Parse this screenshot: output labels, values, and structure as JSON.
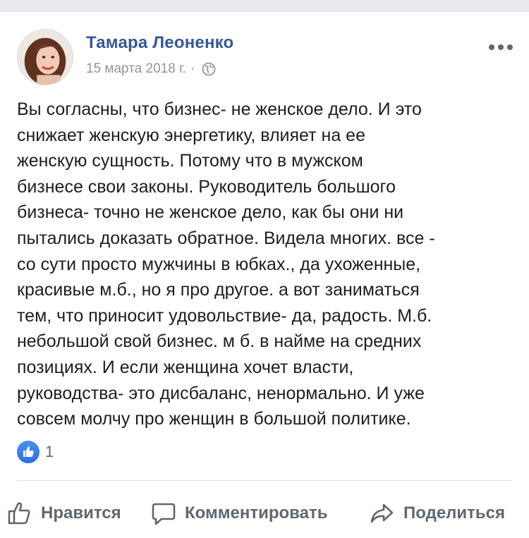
{
  "post": {
    "author": "Тамара Леоненко",
    "date": "15 марта 2018 г.",
    "separator": "·",
    "privacy_icon": "globe-icon",
    "more_icon": "more-horizontal-icon",
    "text": "Вы согласны, что  бизнес- не женское дело. И это\nснижает женскую энергетику, влияет на ее\nженскую сущность. Потому что в мужском\nбизнесе свои законы. Руководитель большого\nбизнеса- точно не женское дело, как бы они ни\nпытались доказать обратное. Видела многих. все -\nсо сути просто мужчины в юбках., да ухоженные,\nкрасивые м.б., но я про другое. а вот заниматься\nтем, что приносит удовольствие- да, радость. М.б.\nнебольшой свой бизнес. м б. в найме на средних\nпозициях. И если женщина хочет власти,\nруководства- это дисбаланс, ненормально. И уже\nсовсем молчу про женщин в большой политике."
  },
  "reactions": {
    "icon": "like-reaction-icon",
    "count": "1"
  },
  "actions": {
    "like_label": "Нравится",
    "comment_label": "Комментировать",
    "share_label": "Поделиться"
  },
  "colors": {
    "author_link": "#365899",
    "meta_gray": "#90949c",
    "action_gray": "#606770",
    "like_blue": "#2d6fe0",
    "background_strip": "#e9ebee"
  }
}
